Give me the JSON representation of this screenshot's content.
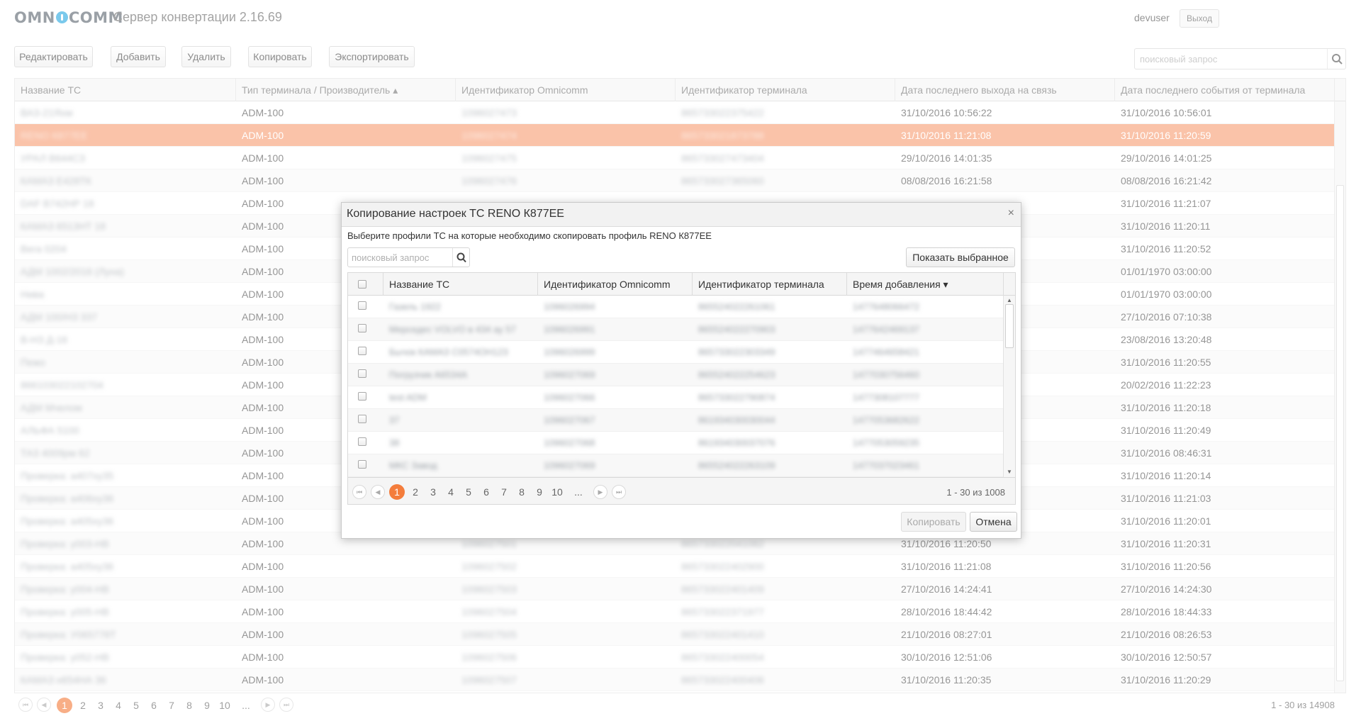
{
  "header": {
    "logo": "OMNICOMM",
    "logo_left": "OMN",
    "logo_right": "COMM",
    "title": "Сервер конвертации 2.16.69",
    "user": "devuser",
    "logout": "Выход"
  },
  "toolbar": {
    "edit": "Редактировать",
    "add": "Добавить",
    "delete": "Удалить",
    "copy": "Копировать",
    "export": "Экспортировать",
    "search_placeholder": "поисковый запрос"
  },
  "grid": {
    "columns": [
      "Название ТС",
      "Тип терминала / Производитель ▴",
      "Идентификатор Omnicomm",
      "Идентификатор терминала",
      "Дата последнего выхода на связь",
      "Дата последнего события от терминала"
    ],
    "rows": [
      {
        "name": "ВАЗ-21Яхм",
        "type": "ADM-100",
        "omni": "1096027473",
        "term": "865733022375422",
        "last_conn": "31/10/2016 10:56:22",
        "last_event": "31/10/2016 10:56:01"
      },
      {
        "name": "RENO К877ЕЕ",
        "type": "ADM-100",
        "omni": "1096027474",
        "term": "865733021873788",
        "last_conn": "31/10/2016 11:21:08",
        "last_event": "31/10/2016 11:20:59",
        "selected": true
      },
      {
        "name": "УРАЛ В644СЗ",
        "type": "ADM-100",
        "omni": "1096027475",
        "term": "865733027473404",
        "last_conn": "29/10/2016 14:01:35",
        "last_event": "29/10/2016 14:01:25"
      },
      {
        "name": "КАМАЗ Е428ТК",
        "type": "ADM-100",
        "omni": "1096027476",
        "term": "865733027365060",
        "last_conn": "08/08/2016 16:21:58",
        "last_event": "08/08/2016 16:21:42"
      },
      {
        "name": "DAF В742НР 18",
        "type": "ADM-100",
        "omni": "",
        "term": "",
        "last_conn": "",
        "last_event": "31/10/2016 11:21:07"
      },
      {
        "name": "КАМАЗ 6513НТ 18",
        "type": "ADM-100",
        "omni": "",
        "term": "",
        "last_conn": "",
        "last_event": "31/10/2016 11:20:11"
      },
      {
        "name": "Вега 0204",
        "type": "ADM-100",
        "omni": "",
        "term": "",
        "last_conn": "",
        "last_event": "31/10/2016 11:20:52"
      },
      {
        "name": "АДМ 1002/2016 (Луна)",
        "type": "ADM-100",
        "omni": "",
        "term": "",
        "last_conn": "",
        "last_event": "01/01/1970 03:00:00"
      },
      {
        "name": "Нива",
        "type": "ADM-100",
        "omni": "",
        "term": "",
        "last_conn": "",
        "last_event": "01/01/1970 03:00:00"
      },
      {
        "name": "АДМ 100/НЗ 337",
        "type": "ADM-100",
        "omni": "",
        "term": "",
        "last_conn": "",
        "last_event": "27/10/2016 07:10:38"
      },
      {
        "name": "В-НЗ Д-16",
        "type": "ADM-100",
        "omni": "",
        "term": "",
        "last_conn": "",
        "last_event": "23/08/2016 13:20:48"
      },
      {
        "name": "Пежо",
        "type": "ADM-100",
        "omni": "",
        "term": "",
        "last_conn": "",
        "last_event": "31/10/2016 11:20:55"
      },
      {
        "name": "866103022102704",
        "type": "ADM-100",
        "omni": "",
        "term": "",
        "last_conn": "",
        "last_event": "20/02/2016 11:22:23"
      },
      {
        "name": "АДМ Мчелом",
        "type": "ADM-100",
        "omni": "",
        "term": "",
        "last_conn": "",
        "last_event": "31/10/2016 11:20:18"
      },
      {
        "name": "АЛЬФА 5100",
        "type": "ADM-100",
        "omni": "",
        "term": "",
        "last_conn": "",
        "last_event": "31/10/2016 11:20:49"
      },
      {
        "name": "ТАЗ 4009рм 62",
        "type": "ADM-100",
        "omni": "",
        "term": "",
        "last_conn": "",
        "last_event": "31/10/2016 08:46:31"
      },
      {
        "name": "Проверка: а407ху35",
        "type": "ADM-100",
        "omni": "",
        "term": "",
        "last_conn": "",
        "last_event": "31/10/2016 11:20:14"
      },
      {
        "name": "Проверка: а406ху36",
        "type": "ADM-100",
        "omni": "",
        "term": "",
        "last_conn": "",
        "last_event": "31/10/2016 11:21:03"
      },
      {
        "name": "Проверка: а405ху36",
        "type": "ADM-100",
        "omni": "",
        "term": "",
        "last_conn": "",
        "last_event": "31/10/2016 11:20:01"
      },
      {
        "name": "Проверка: у003-НВ",
        "type": "ADM-100",
        "omni": "1096027501",
        "term": "865733022041062",
        "last_conn": "31/10/2016 11:20:50",
        "last_event": "31/10/2016 11:20:31"
      },
      {
        "name": "Проверка: а405ху36",
        "type": "ADM-100",
        "omni": "1096027502",
        "term": "865733022402900",
        "last_conn": "31/10/2016 11:21:08",
        "last_event": "31/10/2016 11:20:56"
      },
      {
        "name": "Проверка: у004-НВ",
        "type": "ADM-100",
        "omni": "1096027503",
        "term": "865733022401409",
        "last_conn": "27/10/2016 14:24:41",
        "last_event": "27/10/2016 14:24:30"
      },
      {
        "name": "Проверка: у005-НВ",
        "type": "ADM-100",
        "omni": "1096027504",
        "term": "865733022371977",
        "last_conn": "28/10/2016 18:44:42",
        "last_event": "28/10/2016 18:44:33"
      },
      {
        "name": "Проверка: У065778Т",
        "type": "ADM-100",
        "omni": "1096027505",
        "term": "865733022401410",
        "last_conn": "21/10/2016 08:27:01",
        "last_event": "21/10/2016 08:26:53"
      },
      {
        "name": "Проверка: у052-НВ",
        "type": "ADM-100",
        "omni": "1096027506",
        "term": "865733022400054",
        "last_conn": "30/10/2016 12:51:06",
        "last_event": "30/10/2016 12:50:57"
      },
      {
        "name": "КАМАЗ н654НА 36",
        "type": "ADM-100",
        "omni": "1096027507",
        "term": "865733022400406",
        "last_conn": "31/10/2016 11:20:35",
        "last_event": "31/10/2016 11:20:29"
      }
    ]
  },
  "pager": {
    "pages": [
      "1",
      "2",
      "3",
      "4",
      "5",
      "6",
      "7",
      "8",
      "9",
      "10",
      "..."
    ],
    "active": "1",
    "info": "1 - 30 из 14908"
  },
  "modal": {
    "title": "Копирование настроек ТС RENO К877ЕЕ",
    "close": "×",
    "subtitle": "Выберите профили ТС на которые необходимо скопировать профиль RENO К877ЕЕ",
    "search_placeholder": "поисковый запрос",
    "show_selected": "Показать выбранное",
    "columns": [
      "Название ТС",
      "Идентификатор Omnicomm",
      "Идентификатор терминала",
      "Время добавления ▾"
    ],
    "rows": [
      {
        "name": "Газель 1922",
        "omni": "1096026994",
        "term": "865524022261061",
        "added": "1477648066472"
      },
      {
        "name": "Мерседес VOLVO в 434 ау 57",
        "omni": "1096026991",
        "term": "865524022270903",
        "added": "1477642469137"
      },
      {
        "name": "Бычок КАМАЗ С0574ОН123",
        "omni": "1096026999",
        "term": "865733022303349",
        "added": "1477464658421"
      },
      {
        "name": "Погрузчик А6534А",
        "omni": "1096027069",
        "term": "865524022254623",
        "added": "1477030756460"
      },
      {
        "name": "test ADM",
        "omni": "1096027066",
        "term": "865733022790874",
        "added": "1477308107777"
      },
      {
        "name": "37",
        "omni": "1096027067",
        "term": "861934030030044",
        "added": "1477053682622"
      },
      {
        "name": "38",
        "omni": "1096027068",
        "term": "861934030037076",
        "added": "1477053059235"
      },
      {
        "name": "МКС Завод",
        "omni": "1096027069",
        "term": "865524022263109",
        "added": "1477037023461"
      }
    ],
    "pages": [
      "1",
      "2",
      "3",
      "4",
      "5",
      "6",
      "7",
      "8",
      "9",
      "10",
      "..."
    ],
    "active_page": "1",
    "info": "1 - 30 из 1008",
    "copy": "Копировать",
    "cancel": "Отмена"
  },
  "colors": {
    "selected_row": "#f79e75",
    "active_page": "#f47d3c",
    "logo_dot": "#29a9e0"
  }
}
